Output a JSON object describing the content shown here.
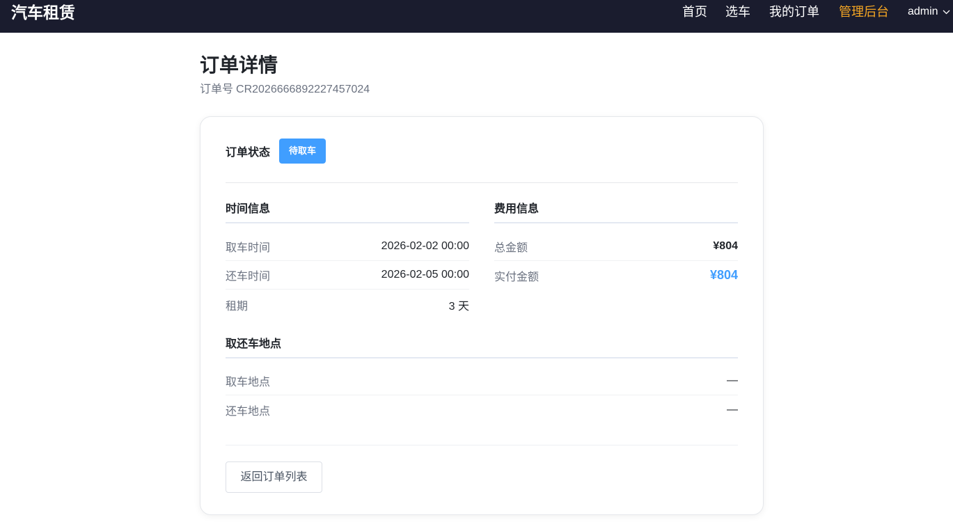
{
  "navbar": {
    "brand": "汽车租赁",
    "links": {
      "home": "首页",
      "cars": "选车",
      "orders": "我的订单",
      "admin": "管理后台"
    },
    "user": "admin",
    "admin_color": "#f5a623"
  },
  "header": {
    "title": "订单详情",
    "order_no_label": "订单号",
    "order_no": "CR2026666892227457024"
  },
  "status": {
    "label": "订单状态",
    "badge": "待取车",
    "badge_color": "#409eff"
  },
  "time_info": {
    "title": "时间信息",
    "pickup_label": "取车时间",
    "pickup_value": "2026-02-02 00:00",
    "return_label": "还车时间",
    "return_value": "2026-02-05 00:00",
    "days_label": "租期",
    "days_value": "3 天"
  },
  "fee_info": {
    "title": "费用信息",
    "total_label": "总金额",
    "total_value": "¥804",
    "paid_label": "实付金额",
    "paid_value": "¥804"
  },
  "location_info": {
    "title": "取还车地点",
    "pickup_label": "取车地点",
    "pickup_value": "—",
    "return_label": "还车地点",
    "return_value": "—"
  },
  "actions": {
    "back_label": "返回订单列表"
  },
  "icons": {
    "user_menu": "chevron-down-icon"
  }
}
